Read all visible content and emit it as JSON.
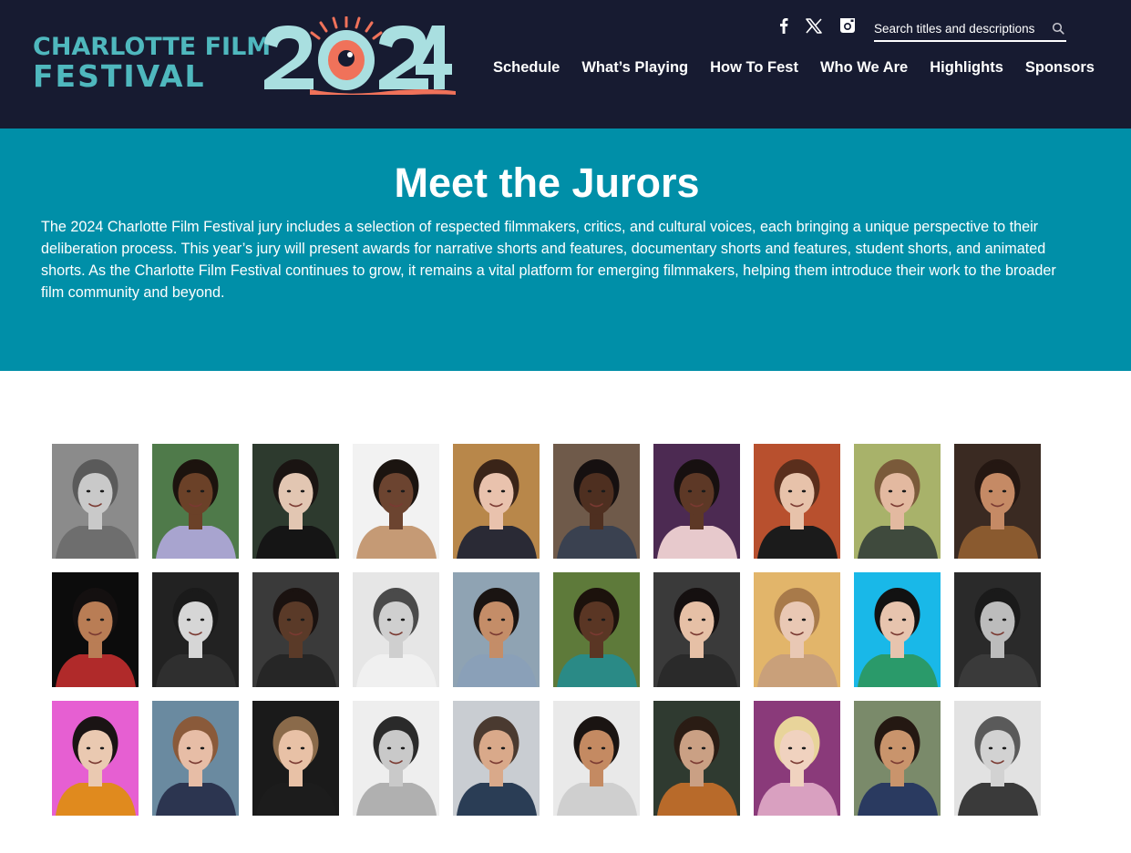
{
  "header": {
    "logo": {
      "line1": "CHARLOTTE FILM",
      "line2": "FESTIVAL",
      "year": "2024"
    },
    "social": [
      {
        "name": "facebook",
        "icon": "facebook-icon"
      },
      {
        "name": "x",
        "icon": "x-icon"
      },
      {
        "name": "instagram",
        "icon": "instagram-icon"
      }
    ],
    "search": {
      "placeholder": "Search titles and descriptions",
      "icon": "search-icon"
    },
    "nav": [
      "Schedule",
      "What’s Playing",
      "How To Fest",
      "Who We Are",
      "Highlights",
      "Sponsors"
    ]
  },
  "hero": {
    "title": "Meet the Jurors",
    "description": "The 2024 Charlotte Film Festival jury includes a selection of respected filmmakers, critics, and cultural voices, each bringing a unique perspective to their deliberation process. This year’s jury will present awards for narrative shorts and features, documentary shorts and features, student shorts, and animated shorts. As the Charlotte Film Festival continues to grow, it remains a vital platform for emerging filmmakers, helping them introduce their work to the broader film community and beyond."
  },
  "colors": {
    "header_bg": "#171b31",
    "hero_bg": "#008fa8",
    "logo_teal": "#4fb8be",
    "logo_year": "#a9dfe0",
    "logo_coral": "#f0725a"
  },
  "jurors": [
    {
      "bg": "#8b8b8b",
      "skin": "#c9c9c9",
      "hair": "#5a5a5a",
      "shirt": "#6e6e6e"
    },
    {
      "bg": "#4f7a4a",
      "skin": "#6b4128",
      "hair": "#1c130e",
      "shirt": "#a8a4cf"
    },
    {
      "bg": "#2d3a2e",
      "skin": "#e2c6b2",
      "hair": "#1a1412",
      "shirt": "#151515"
    },
    {
      "bg": "#f2f2f2",
      "skin": "#6c4430",
      "hair": "#1b1410",
      "shirt": "#c59a75"
    },
    {
      "bg": "#b8874a",
      "skin": "#e9c2ad",
      "hair": "#3a2418",
      "shirt": "#2a2a35"
    },
    {
      "bg": "#6f5a4a",
      "skin": "#4e2f20",
      "hair": "#161010",
      "shirt": "#3a4150"
    },
    {
      "bg": "#4c2a52",
      "skin": "#5d3826",
      "hair": "#171010",
      "shirt": "#e7c9cc"
    },
    {
      "bg": "#b8502e",
      "skin": "#e7c2aa",
      "hair": "#5a2e1c",
      "shirt": "#1b1b1b"
    },
    {
      "bg": "#a8b26a",
      "skin": "#e3b9a0",
      "hair": "#7a5a3a",
      "shirt": "#3f4a3d"
    },
    {
      "bg": "#3a2a22",
      "skin": "#c58a65",
      "hair": "#241712",
      "shirt": "#8a5a2f"
    },
    {
      "bg": "#0c0c0c",
      "skin": "#b97d55",
      "hair": "#141010",
      "shirt": "#b02a2a"
    },
    {
      "bg": "#222222",
      "skin": "#d6d6d6",
      "hair": "#1a1a1a",
      "shirt": "#2f2f2f"
    },
    {
      "bg": "#3a3a3a",
      "skin": "#5a3a28",
      "hair": "#1a1210",
      "shirt": "#262626"
    },
    {
      "bg": "#e6e6e6",
      "skin": "#cfcfcf",
      "hair": "#4a4a4a",
      "shirt": "#f0f0f0"
    },
    {
      "bg": "#8fa3b3",
      "skin": "#c48d68",
      "hair": "#1a1412",
      "shirt": "#8aa0b8"
    },
    {
      "bg": "#5e7a3a",
      "skin": "#5a3624",
      "hair": "#1c120c",
      "shirt": "#2a8a86"
    },
    {
      "bg": "#3a3a3a",
      "skin": "#e6c0a6",
      "hair": "#151010",
      "shirt": "#2a2a2a"
    },
    {
      "bg": "#e2b56a",
      "skin": "#e9c8b4",
      "hair": "#a87a4a",
      "shirt": "#c9a07a"
    },
    {
      "bg": "#19b8e8",
      "skin": "#e7c4ae",
      "hair": "#121212",
      "shirt": "#2a9a6a"
    },
    {
      "bg": "#2a2a2a",
      "skin": "#bcbcbc",
      "hair": "#1a1a1a",
      "shirt": "#3a3a3a"
    },
    {
      "bg": "#e65fd2",
      "skin": "#eac9b1",
      "hair": "#1a1414",
      "shirt": "#e08a1e"
    },
    {
      "bg": "#6a8aa0",
      "skin": "#e7bda6",
      "hair": "#8a5a3a",
      "shirt": "#2c3550"
    },
    {
      "bg": "#1a1a1a",
      "skin": "#e8c1a6",
      "hair": "#8a6a4a",
      "shirt": "#1c1c1c"
    },
    {
      "bg": "#eeeeee",
      "skin": "#c9c9c9",
      "hair": "#2a2a2a",
      "shirt": "#b0b0b0"
    },
    {
      "bg": "#c9cdd2",
      "skin": "#d9a98a",
      "hair": "#4a3a30",
      "shirt": "#2a3d55"
    },
    {
      "bg": "#e9e9e9",
      "skin": "#c48a62",
      "hair": "#1a1412",
      "shirt": "#cfcfcf"
    },
    {
      "bg": "#2f3a30",
      "skin": "#caa084",
      "hair": "#2a1c14",
      "shirt": "#b86a2a"
    },
    {
      "bg": "#8a3a7a",
      "skin": "#f0d2bf",
      "hair": "#e8d49a",
      "shirt": "#d9a0c0"
    },
    {
      "bg": "#7a8a6a",
      "skin": "#c9946c",
      "hair": "#241812",
      "shirt": "#2a3a60"
    },
    {
      "bg": "#e2e2e2",
      "skin": "#d2d2d2",
      "hair": "#5a5a5a",
      "shirt": "#3a3a3a"
    }
  ]
}
